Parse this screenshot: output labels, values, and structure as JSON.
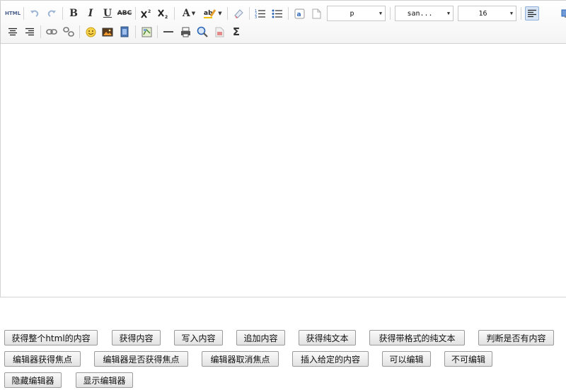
{
  "toolbar": {
    "paragraph_select": "p",
    "font_family_select": "san...",
    "font_size_select": "16",
    "icons": {
      "source": "html-source-icon",
      "undo": "undo-icon",
      "redo": "redo-icon",
      "bold": "bold-icon",
      "italic": "italic-icon",
      "underline": "underline-icon",
      "strikethrough": "strikethrough-icon",
      "superscript": "superscript-icon",
      "subscript": "subscript-icon",
      "forecolor": "font-color-icon",
      "backcolor": "highlight-color-icon",
      "removeformat": "eraser-icon",
      "ordered_list": "ordered-list-icon",
      "unordered_list": "unordered-list-icon",
      "anchor": "anchor-icon",
      "paste_plain": "paste-plain-icon",
      "justify_left": "align-left-icon",
      "fullscreen": "fullscreen-icon",
      "justify_center": "align-center-icon",
      "justify_right": "align-right-icon",
      "link": "link-icon",
      "unlink": "unlink-icon",
      "emotion": "emoticon-icon",
      "image": "image-icon",
      "video": "video-icon",
      "map": "map-icon",
      "horizontal": "horizontal-rule-icon",
      "print": "print-icon",
      "preview": "preview-icon",
      "cleardoc": "clear-document-icon",
      "formula": "sigma-icon"
    },
    "glyphs": {
      "html": "HTML",
      "bold": "B",
      "italic": "I",
      "underline": "U",
      "strike": "ABC",
      "font_color": "A",
      "highlight": "ab",
      "anchor": "a",
      "sigma": "Σ"
    }
  },
  "buttons": {
    "row1": [
      "获得整个html的内容",
      "获得内容",
      "写入内容",
      "追加内容",
      "获得纯文本",
      "获得带格式的纯文本",
      "判断是否有内容"
    ],
    "row2": [
      "编辑器获得焦点",
      "编辑器是否获得焦点",
      "编辑器取消焦点",
      "插入给定的内容",
      "可以编辑",
      "不可编辑"
    ],
    "row3": [
      "隐藏编辑器",
      "显示编辑器"
    ]
  },
  "colors": {
    "accent_blue": "#2a64b5",
    "toolbar_bg": "#f4f4f4",
    "border": "#d4d4d4"
  }
}
